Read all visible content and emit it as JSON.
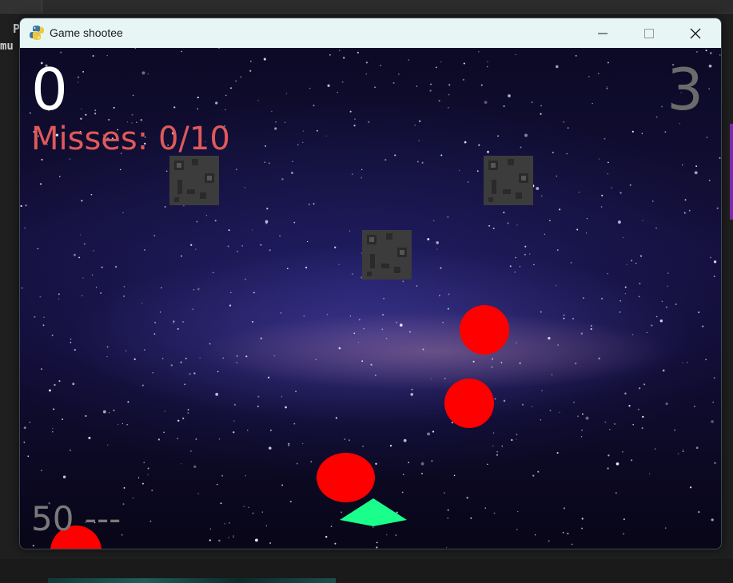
{
  "window": {
    "title": "Game shootee"
  },
  "desktop": {
    "bg_char_1": "P",
    "bg_text_2": "mu"
  },
  "hud": {
    "score": "0",
    "lives": "3",
    "misses_label": "Misses: ",
    "misses_value": "0/10",
    "ammo": "50 ---"
  },
  "colors": {
    "score": "#ffffff",
    "lives": "#6b6b6b",
    "misses": "#e05a5a",
    "ammo": "#7a7a7a",
    "enemy": "#ff0000",
    "player": "#1aff8c",
    "obstacle": "#3c3c3c",
    "titlebar": "#e8f5f5"
  },
  "icons": {
    "app": "python-snake-icon",
    "minimize": "minimize-icon",
    "maximize": "maximize-icon",
    "close": "close-icon"
  }
}
